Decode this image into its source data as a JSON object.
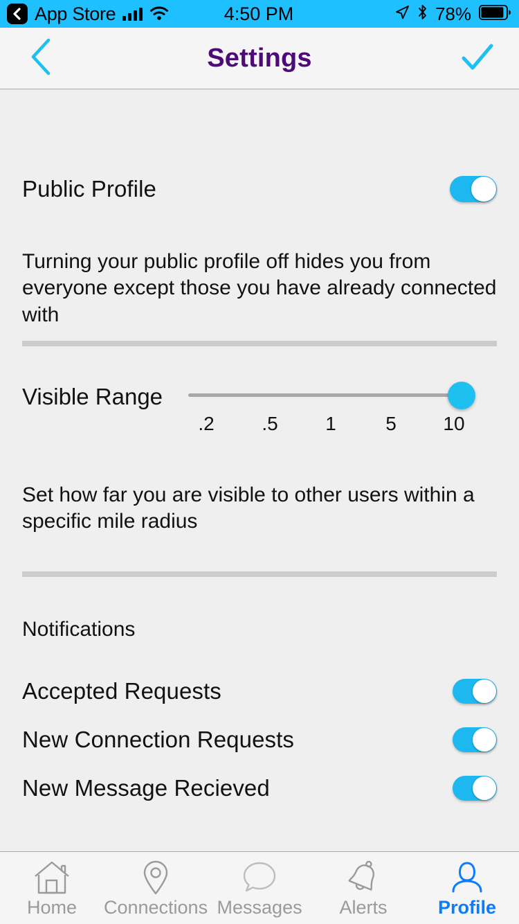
{
  "status_bar": {
    "back_label": "App Store",
    "back_icon": "chevron-left-icon",
    "signal_icon": "cellular-signal-icon",
    "wifi_icon": "wifi-icon",
    "time": "4:50 PM",
    "location_icon": "location-arrow-icon",
    "bluetooth_icon": "bluetooth-icon",
    "battery_percent": "78%",
    "battery_icon": "battery-icon",
    "background_color": "#1EC0FF"
  },
  "nav_bar": {
    "back_icon": "chevron-left-icon",
    "title": "Settings",
    "done_icon": "checkmark-icon",
    "title_color": "#4D0B78",
    "accent_color": "#1EC0F0"
  },
  "public_profile": {
    "label": "Public Profile",
    "toggle_on": true,
    "description": "Turning your public profile off hides you from everyone except those you have already connected with"
  },
  "visible_range": {
    "label": "Visible Range",
    "ticks": [
      ".2",
      ".5",
      "1",
      "5",
      "10"
    ],
    "selected_value": "10",
    "description": "Set how far you are visible to other users within a specific mile radius",
    "thumb_color": "#1EC0F0"
  },
  "notifications": {
    "section_title": "Notifications",
    "items": [
      {
        "label": "Accepted Requests",
        "toggle_on": true
      },
      {
        "label": "New Connection Requests",
        "toggle_on": true
      },
      {
        "label": "New Message Recieved",
        "toggle_on": true
      }
    ]
  },
  "tab_bar": {
    "active_color": "#0A7CFF",
    "inactive_color": "#9A9A9A",
    "tabs": [
      {
        "label": "Home",
        "icon": "home-icon",
        "active": false
      },
      {
        "label": "Connections",
        "icon": "map-pin-icon",
        "active": false
      },
      {
        "label": "Messages",
        "icon": "speech-bubble-icon",
        "active": false
      },
      {
        "label": "Alerts",
        "icon": "bell-icon",
        "active": false
      },
      {
        "label": "Profile",
        "icon": "person-icon",
        "active": true
      }
    ]
  }
}
